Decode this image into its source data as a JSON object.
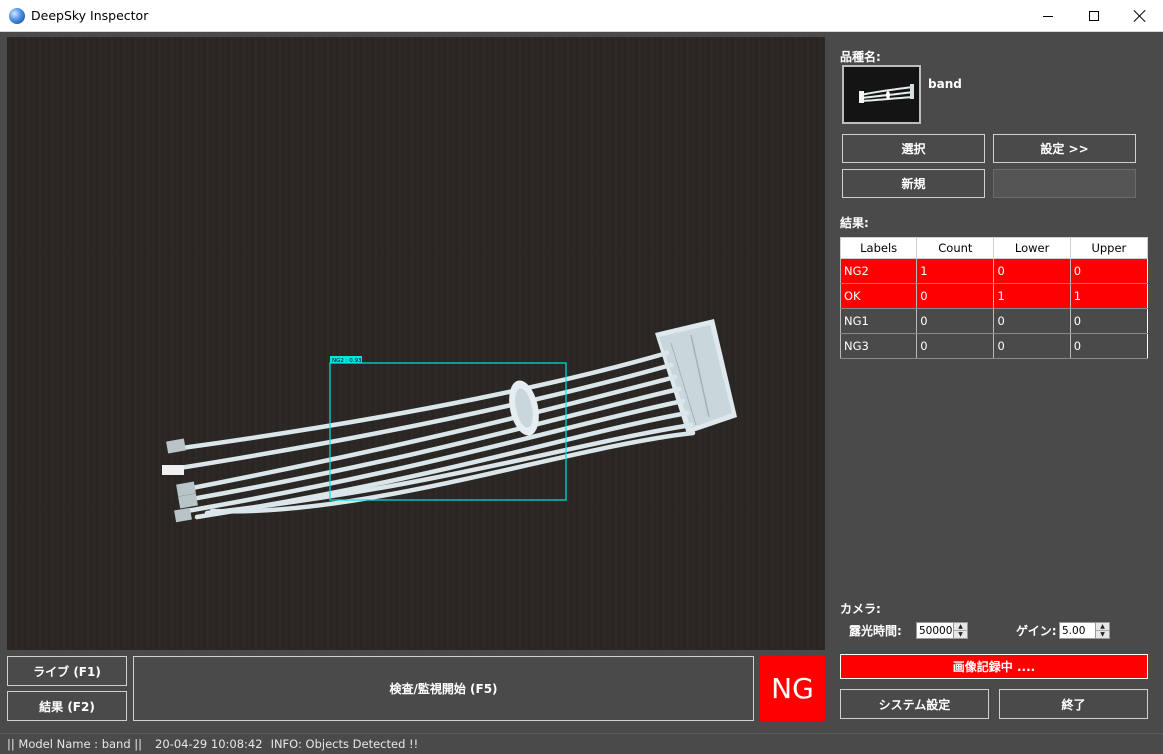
{
  "window": {
    "title": "DeepSky Inspector",
    "icon": "globe-icon"
  },
  "camera_view": {
    "detection_label": "NG2 : 0.93",
    "detection_color": "#00e5e5"
  },
  "buttons": {
    "live": "ライブ (F1)",
    "result": "結果 (F2)",
    "inspect": "検査/監視開始 (F5)",
    "select": "選択",
    "settings": "設定 >>",
    "new": "新規",
    "system_settings": "システム設定",
    "exit": "終了"
  },
  "judgement": {
    "text": "NG",
    "color": "#ff0000"
  },
  "model": {
    "label": "品種名:",
    "name": "band"
  },
  "results": {
    "label": "結果:",
    "columns": [
      "Labels",
      "Count",
      "Lower",
      "Upper"
    ],
    "rows": [
      {
        "label": "NG2",
        "count": "1",
        "lower": "0",
        "upper": "0",
        "highlight": true
      },
      {
        "label": "OK",
        "count": "0",
        "lower": "1",
        "upper": "1",
        "highlight": true
      },
      {
        "label": "NG1",
        "count": "0",
        "lower": "0",
        "upper": "0",
        "highlight": false
      },
      {
        "label": "NG3",
        "count": "0",
        "lower": "0",
        "upper": "0",
        "highlight": false
      }
    ]
  },
  "camera": {
    "label": "カメラ:",
    "exposure_label": "露光時間:",
    "exposure_value": "50000",
    "gain_label": "ゲイン:",
    "gain_value": "5.00"
  },
  "recording": {
    "text": "画像記録中 ...."
  },
  "status": {
    "model": "|| Model Name : band ||",
    "time": "20-04-29 10:08:42",
    "info": "INFO:   Objects Detected !!"
  }
}
